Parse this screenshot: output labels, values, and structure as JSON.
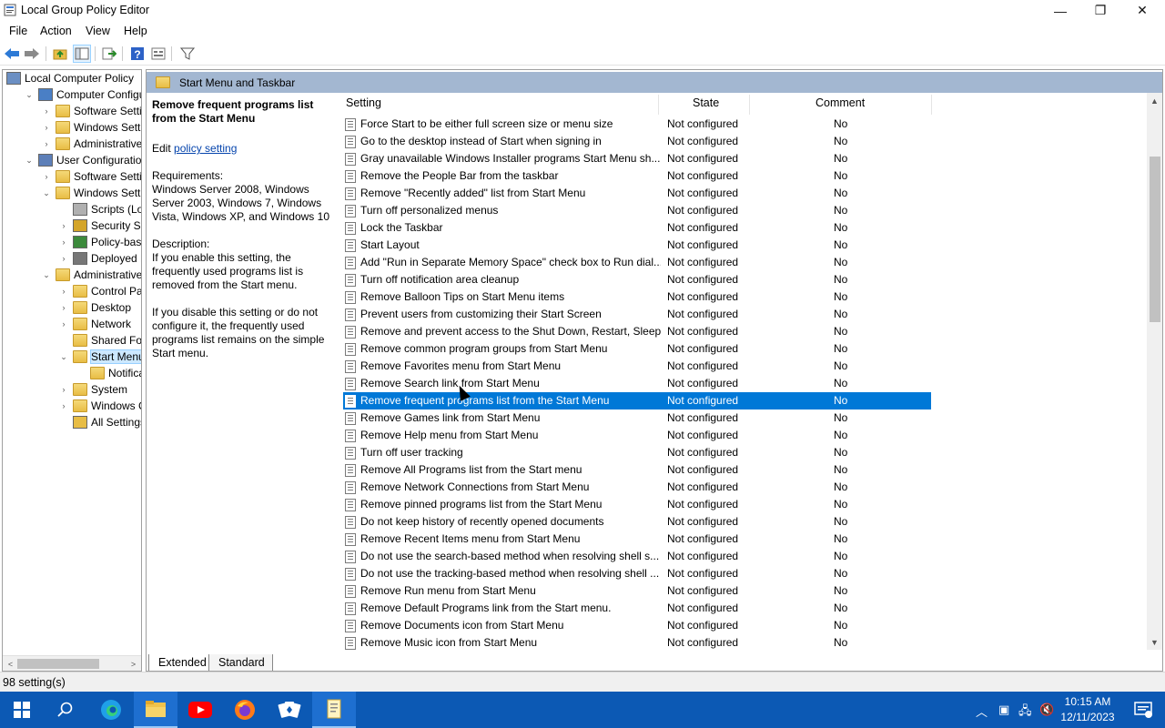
{
  "window": {
    "title": "Local Group Policy Editor",
    "minimize": "—",
    "maximize": "❐",
    "close": "✕"
  },
  "menu": [
    "File",
    "Action",
    "View",
    "Help"
  ],
  "tree": [
    {
      "label": "Local Computer Policy",
      "exp": "",
      "icon": "computer-policy-icon",
      "level": 0
    },
    {
      "label": "Computer Configura",
      "exp": "v",
      "icon": "computer-icon",
      "level": 1
    },
    {
      "label": "Software Settings",
      "exp": ">",
      "icon": "folder-icon",
      "level": 2
    },
    {
      "label": "Windows Setting",
      "exp": ">",
      "icon": "folder-icon",
      "level": 2
    },
    {
      "label": "Administrative Te",
      "exp": ">",
      "icon": "folder-icon",
      "level": 2
    },
    {
      "label": "User Configuration",
      "exp": "v",
      "icon": "user-icon",
      "level": 1
    },
    {
      "label": "Software Settings",
      "exp": ">",
      "icon": "folder-icon",
      "level": 2
    },
    {
      "label": "Windows Setting",
      "exp": "v",
      "icon": "folder-icon",
      "level": 2
    },
    {
      "label": "Scripts (Logon",
      "exp": "",
      "icon": "scripts-icon",
      "level": 3
    },
    {
      "label": "Security Settin",
      "exp": ">",
      "icon": "security-icon",
      "level": 3
    },
    {
      "label": "Policy-based",
      "exp": ">",
      "icon": "chart-icon",
      "level": 3
    },
    {
      "label": "Deployed Prin",
      "exp": ">",
      "icon": "printer-icon",
      "level": 3
    },
    {
      "label": "Administrative Te",
      "exp": "v",
      "icon": "folder-icon",
      "level": 2
    },
    {
      "label": "Control Panel",
      "exp": ">",
      "icon": "folder-icon",
      "level": 3
    },
    {
      "label": "Desktop",
      "exp": ">",
      "icon": "folder-icon",
      "level": 3
    },
    {
      "label": "Network",
      "exp": ">",
      "icon": "folder-icon",
      "level": 3
    },
    {
      "label": "Shared Folder",
      "exp": "",
      "icon": "folder-icon",
      "level": 3
    },
    {
      "label": "Start Menu ar",
      "exp": "v",
      "icon": "folder-icon",
      "level": 3,
      "selected": true
    },
    {
      "label": "Notificatio",
      "exp": "",
      "icon": "folder-icon",
      "level": 4
    },
    {
      "label": "System",
      "exp": ">",
      "icon": "folder-icon",
      "level": 3
    },
    {
      "label": "Windows Cor",
      "exp": ">",
      "icon": "folder-icon",
      "level": 3
    },
    {
      "label": "All Settings",
      "exp": "",
      "icon": "all-settings-icon",
      "level": 3
    }
  ],
  "pane_header": "Start Menu and Taskbar",
  "desc": {
    "title": "Remove frequent programs list from the Start Menu",
    "edit_prefix": "Edit",
    "edit_link": "policy setting",
    "req_label": "Requirements:",
    "req_text": "Windows Server 2008, Windows Server 2003, Windows 7, Windows Vista, Windows XP, and Windows 10",
    "desc_label": "Description:",
    "desc_p1": "If you enable this setting, the frequently used programs list is removed from the Start menu.",
    "desc_p2": "If you disable this setting or do not configure it, the frequently used programs list remains on the simple Start menu."
  },
  "columns": {
    "setting": "Setting",
    "state": "State",
    "comment": "Comment"
  },
  "rows": [
    {
      "setting": "Force Start to be either full screen size or menu size",
      "state": "Not configured",
      "comment": "No"
    },
    {
      "setting": "Go to the desktop instead of Start when signing in",
      "state": "Not configured",
      "comment": "No"
    },
    {
      "setting": "Gray unavailable Windows Installer programs Start Menu sh...",
      "state": "Not configured",
      "comment": "No"
    },
    {
      "setting": "Remove the People Bar from the taskbar",
      "state": "Not configured",
      "comment": "No"
    },
    {
      "setting": "Remove \"Recently added\" list from Start Menu",
      "state": "Not configured",
      "comment": "No"
    },
    {
      "setting": "Turn off personalized menus",
      "state": "Not configured",
      "comment": "No"
    },
    {
      "setting": "Lock the Taskbar",
      "state": "Not configured",
      "comment": "No"
    },
    {
      "setting": "Start Layout",
      "state": "Not configured",
      "comment": "No"
    },
    {
      "setting": "Add \"Run in Separate Memory Space\" check box to Run dial...",
      "state": "Not configured",
      "comment": "No"
    },
    {
      "setting": "Turn off notification area cleanup",
      "state": "Not configured",
      "comment": "No"
    },
    {
      "setting": "Remove Balloon Tips on Start Menu items",
      "state": "Not configured",
      "comment": "No"
    },
    {
      "setting": "Prevent users from customizing their Start Screen",
      "state": "Not configured",
      "comment": "No"
    },
    {
      "setting": "Remove and prevent access to the Shut Down, Restart, Sleep...",
      "state": "Not configured",
      "comment": "No"
    },
    {
      "setting": "Remove common program groups from Start Menu",
      "state": "Not configured",
      "comment": "No"
    },
    {
      "setting": "Remove Favorites menu from Start Menu",
      "state": "Not configured",
      "comment": "No"
    },
    {
      "setting": "Remove Search link from Start Menu",
      "state": "Not configured",
      "comment": "No"
    },
    {
      "setting": "Remove frequent programs list from the Start Menu",
      "state": "Not configured",
      "comment": "No",
      "selected": true
    },
    {
      "setting": "Remove Games link from Start Menu",
      "state": "Not configured",
      "comment": "No"
    },
    {
      "setting": "Remove Help menu from Start Menu",
      "state": "Not configured",
      "comment": "No"
    },
    {
      "setting": "Turn off user tracking",
      "state": "Not configured",
      "comment": "No"
    },
    {
      "setting": "Remove All Programs list from the Start menu",
      "state": "Not configured",
      "comment": "No"
    },
    {
      "setting": "Remove Network Connections from Start Menu",
      "state": "Not configured",
      "comment": "No"
    },
    {
      "setting": "Remove pinned programs list from the Start Menu",
      "state": "Not configured",
      "comment": "No"
    },
    {
      "setting": "Do not keep history of recently opened documents",
      "state": "Not configured",
      "comment": "No"
    },
    {
      "setting": "Remove Recent Items menu from Start Menu",
      "state": "Not configured",
      "comment": "No"
    },
    {
      "setting": "Do not use the search-based method when resolving shell s...",
      "state": "Not configured",
      "comment": "No"
    },
    {
      "setting": "Do not use the tracking-based method when resolving shell ...",
      "state": "Not configured",
      "comment": "No"
    },
    {
      "setting": "Remove Run menu from Start Menu",
      "state": "Not configured",
      "comment": "No"
    },
    {
      "setting": "Remove Default Programs link from the Start menu.",
      "state": "Not configured",
      "comment": "No"
    },
    {
      "setting": "Remove Documents icon from Start Menu",
      "state": "Not configured",
      "comment": "No"
    },
    {
      "setting": "Remove Music icon from Start Menu",
      "state": "Not configured",
      "comment": "No"
    }
  ],
  "tabs": {
    "extended": "Extended",
    "standard": "Standard"
  },
  "status": "98 setting(s)",
  "clock": {
    "time": "10:15 AM",
    "date": "12/11/2023"
  },
  "colors": {
    "selection": "#0078d7",
    "pane_header": "#a3b7d1",
    "taskbar": "#0c59b4"
  }
}
